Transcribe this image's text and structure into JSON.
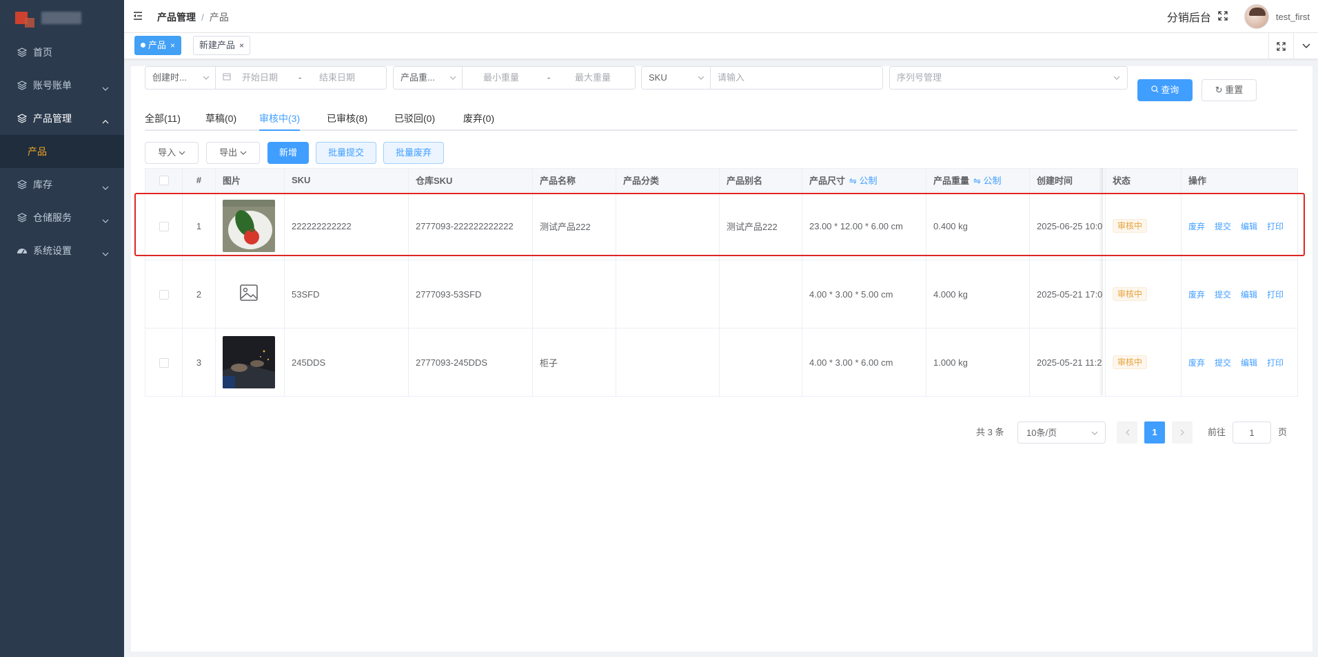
{
  "sidebar": {
    "items": [
      {
        "label": "首页",
        "icon": "layers-icon"
      },
      {
        "label": "账号账单",
        "icon": "layers-icon"
      },
      {
        "label": "产品管理",
        "icon": "layers-icon"
      },
      {
        "label": "产品"
      },
      {
        "label": "库存",
        "icon": "layers-icon"
      },
      {
        "label": "仓储服务",
        "icon": "layers-icon"
      },
      {
        "label": "系统设置",
        "icon": "dashboard-icon"
      }
    ]
  },
  "header": {
    "breadcrumb": [
      "产品管理",
      "产品"
    ],
    "separator": "/",
    "system_label": "分销后台",
    "username": "test_first"
  },
  "tags": [
    {
      "label": "产品",
      "close": "×"
    },
    {
      "label": "新建产品",
      "close": "×"
    }
  ],
  "filters": {
    "date_type": "创建时...",
    "start_date_placeholder": "开始日期",
    "date_sep": "-",
    "end_date_placeholder": "结束日期",
    "weight_type": "产品重...",
    "min_weight_placeholder": "最小重量",
    "weight_sep": "-",
    "max_weight_placeholder": "最大重量",
    "sku_type": "SKU",
    "sku_placeholder": "请输入",
    "serial_placeholder": "序列号管理",
    "query_button": "查询",
    "reset_button": "重置"
  },
  "status_tabs": [
    "全部(11)",
    "草稿(0)",
    "审核中(3)",
    "已审核(8)",
    "已驳回(0)",
    "废弃(0)"
  ],
  "active_tab": "审核中(3)",
  "toolbar": {
    "import": "导入",
    "export": "导出",
    "add": "新增",
    "batch_submit": "批量提交",
    "batch_discard": "批量废弃"
  },
  "table": {
    "columns": [
      "#",
      "图片",
      "SKU",
      "仓库SKU",
      "产品名称",
      "产品分类",
      "产品别名",
      "产品尺寸",
      "产品重量",
      "创建时间",
      "状态",
      "操作"
    ],
    "unit_toggle": "⇋ 公制",
    "rows": [
      {
        "index": "1",
        "sku": "222222222222",
        "warehouse_sku": "2777093-222222222222",
        "name": "测试产品222",
        "category": "",
        "alias": "测试产品222",
        "size": "23.00 * 12.00 * 6.00 cm",
        "weight": "0.400 kg",
        "created": "2025-06-25 10:0",
        "status": "审核中",
        "image": "vegetable-photo"
      },
      {
        "index": "2",
        "sku": "53SFD",
        "warehouse_sku": "2777093-53SFD",
        "name": "",
        "category": "",
        "alias": "",
        "size": "4.00 * 3.00 * 5.00 cm",
        "weight": "4.000 kg",
        "created": "2025-05-21 17:0",
        "status": "审核中",
        "image": "image-placeholder-icon"
      },
      {
        "index": "3",
        "sku": "245DDS",
        "warehouse_sku": "2777093-245DDS",
        "name": "柜子",
        "category": "",
        "alias": "",
        "size": "4.00 * 3.00 * 6.00 cm",
        "weight": "1.000 kg",
        "created": "2025-05-21 11:2",
        "status": "审核中",
        "image": "dark-photo"
      }
    ],
    "actions": [
      "废弃",
      "提交",
      "编辑",
      "打印"
    ]
  },
  "pagination": {
    "total": "共 3 条",
    "page_size": "10条/页",
    "current_page": "1",
    "goto_label": "前往",
    "goto_value": "1",
    "page_suffix": "页"
  },
  "colors": {
    "primary": "#409eff",
    "sidebar": "#2b3a4d",
    "active_menu": "#f5a623",
    "highlight": "#e02424",
    "warning": "#e6a23c"
  }
}
